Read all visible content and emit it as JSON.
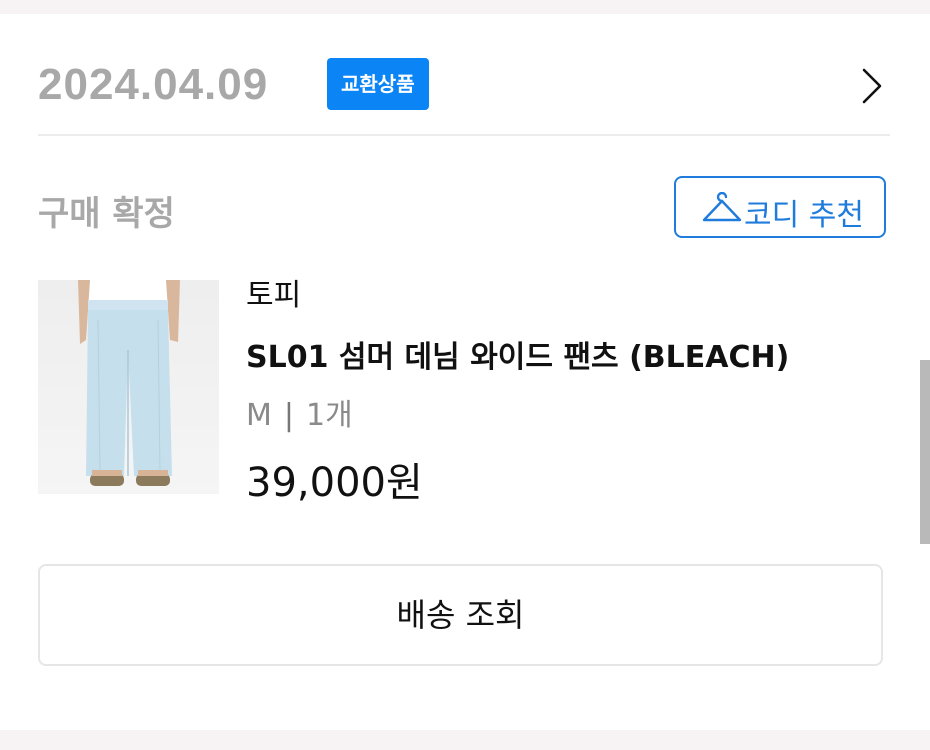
{
  "order": {
    "date": "2024.04.09",
    "badge": "교환상품",
    "status": "구매 확정"
  },
  "coordi_button": {
    "label": "코디 추천",
    "icon": "hanger-icon"
  },
  "product": {
    "brand": "토피",
    "name": "SL01 섬머 데님 와이드 팬츠 (BLEACH)",
    "size": "M",
    "separator": "|",
    "quantity": "1개",
    "price": "39,000원"
  },
  "actions": {
    "delivery": "배송 조회"
  },
  "colors": {
    "badge_bg": "#0b84f5",
    "accent": "#1f7cdc",
    "muted": "#a8a8a8"
  }
}
